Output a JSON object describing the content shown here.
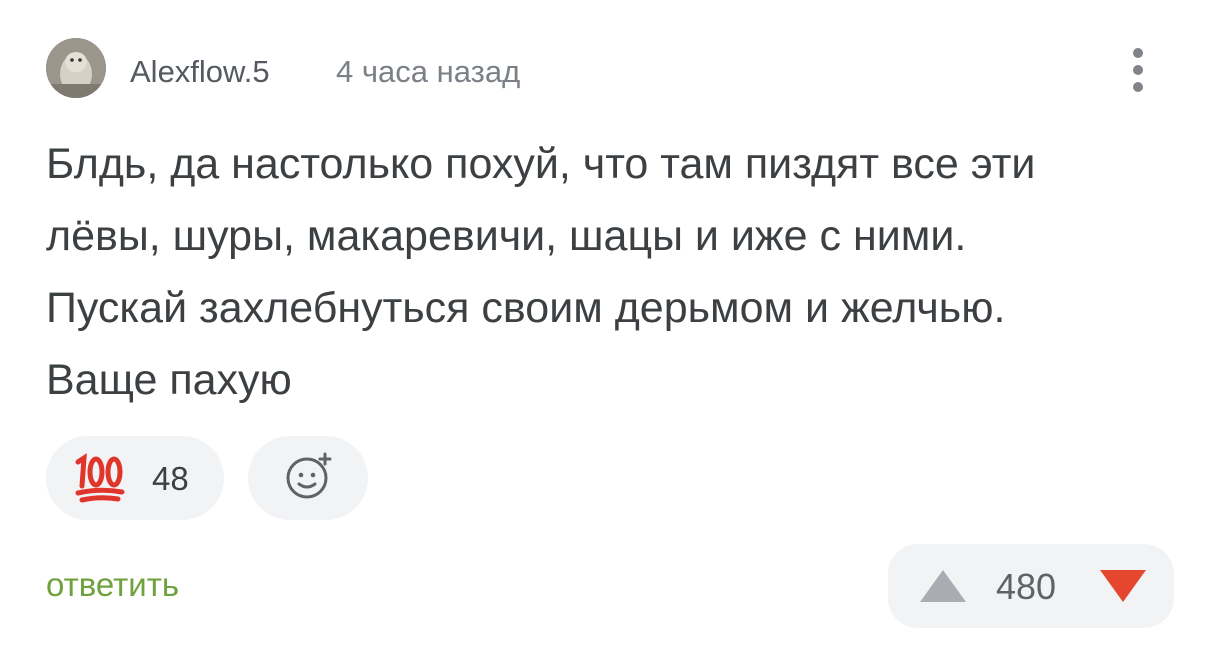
{
  "comment": {
    "author": "Alexflow.5",
    "time": "4 часа назад",
    "text_lines": [
      "Блдь, да настолько похуй, что там пиздят все эти",
      "лёвы, шуры, макаревичи, шацы и иже с ними.",
      "Пускай захлебнуться своим дерьмом и желчью.",
      "Ваще пахую"
    ]
  },
  "reactions": [
    {
      "icon": "hundred-points-icon",
      "count": "48"
    }
  ],
  "actions": {
    "reply_label": "ответить",
    "rating": "480"
  },
  "colors": {
    "reply": "#6fa23e",
    "downvote": "#e4472e",
    "upvote": "#a9adb2",
    "pill_bg": "#f2f3f5"
  }
}
